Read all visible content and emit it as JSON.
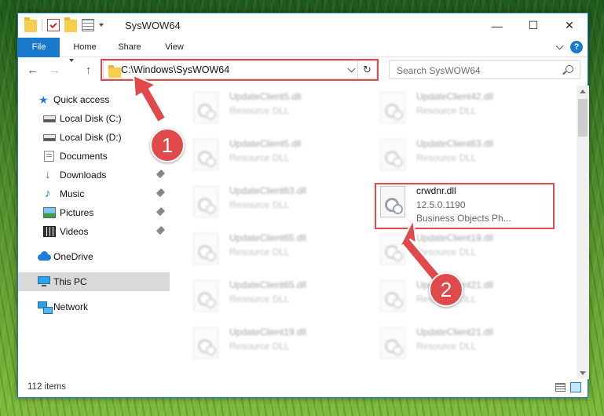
{
  "window": {
    "title": "SysWOW64",
    "controls": {
      "minimize": "—",
      "maximize": "☐",
      "close": "✕"
    }
  },
  "ribbon": {
    "tabs": [
      "File",
      "Home",
      "Share",
      "View"
    ],
    "help": "?"
  },
  "nav": {
    "back": "←",
    "forward": "→",
    "up": "↑",
    "address": "C:\\Windows\\SysWOW64",
    "refresh": "↻",
    "search_placeholder": "Search SysWOW64"
  },
  "sidebar": {
    "items": [
      {
        "label": "Quick access",
        "icon": "star-icon"
      },
      {
        "label": "Local Disk (C:)",
        "icon": "local-disk-icon",
        "pinned": true
      },
      {
        "label": "Local Disk (D:)",
        "icon": "local-disk-icon",
        "pinned": true
      },
      {
        "label": "Documents",
        "icon": "documents-icon",
        "pinned": true
      },
      {
        "label": "Downloads",
        "icon": "downloads-icon",
        "pinned": true
      },
      {
        "label": "Music",
        "icon": "music-icon",
        "pinned": true
      },
      {
        "label": "Pictures",
        "icon": "pictures-icon",
        "pinned": true
      },
      {
        "label": "Videos",
        "icon": "videos-icon",
        "pinned": true
      },
      {
        "label": "OneDrive",
        "icon": "onedrive-icon"
      },
      {
        "label": "This PC",
        "icon": "this-pc-icon",
        "selected": true
      },
      {
        "label": "Network",
        "icon": "network-icon"
      }
    ]
  },
  "files": {
    "left_column": [
      {
        "name": "UpdateClient5.dll",
        "type": "Resource DLL"
      },
      {
        "name": "UpdateClient5.dll",
        "type": "Resource DLL"
      },
      {
        "name": "UpdateClient63.dll",
        "type": "Resource DLL"
      },
      {
        "name": "UpdateClient65.dll",
        "type": "Resource DLL"
      },
      {
        "name": "UpdateClient65.dll",
        "type": "Resource DLL"
      },
      {
        "name": "UpdateClient19.dll",
        "type": "Resource DLL"
      }
    ],
    "right_column": [
      {
        "name": "UpdateClient42.dll",
        "type": "Resource DLL"
      },
      {
        "name": "UpdateClient63.dll",
        "type": "Resource DLL"
      },
      {
        "name": "crwdnr.dll",
        "version": "12.5.0.1190",
        "type": "Business Objects Ph..."
      },
      {
        "name": "UpdateClient19.dll",
        "type": "Resource DLL"
      },
      {
        "name": "UpdateClient21.dll",
        "type": "Resource DLL"
      },
      {
        "name": "UpdateClient21.dll",
        "type": "Resource DLL"
      }
    ]
  },
  "status": {
    "item_count": "112 items"
  },
  "annotations": {
    "step1": "1",
    "step2": "2",
    "color": "#e04a4a"
  }
}
